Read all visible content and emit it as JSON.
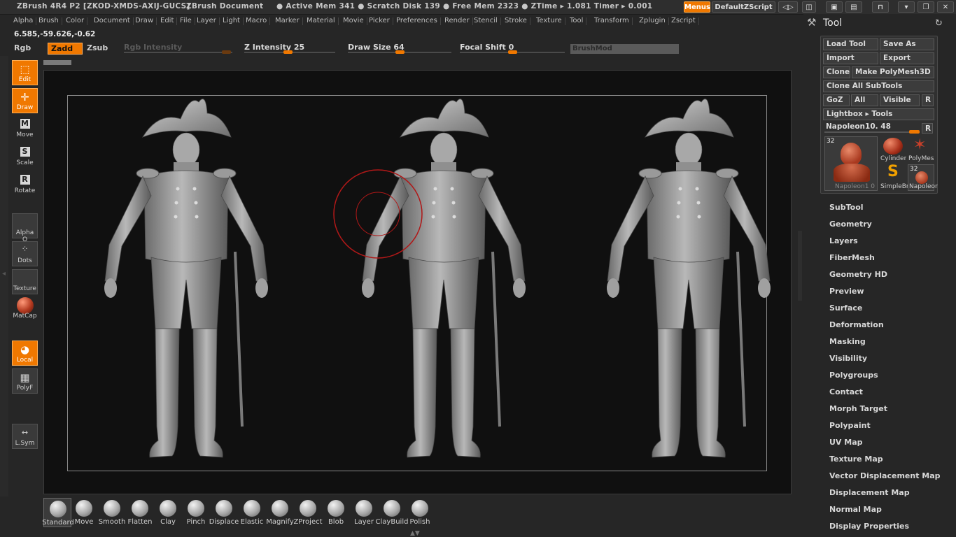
{
  "titlebar": {
    "app": "ZBrush 4R4 P2 [ZKOD-XMDS-AXIJ-GUCS]",
    "doc": "ZBrush Document",
    "stats": "● Active Mem 341  ● Scratch Disk 139  ● Free Mem 2323  ● ZTime ▸ 1.081  Timer ▸ 0.001",
    "menus_btn": "Menus",
    "script_btn": "DefaultZScript"
  },
  "menubar": {
    "items": [
      "Alpha",
      "Brush",
      "Color",
      "Document",
      "Draw",
      "Edit",
      "File",
      "Layer",
      "Light",
      "Macro",
      "Marker",
      "Material",
      "Movie",
      "Picker",
      "Preferences",
      "Render",
      "Stencil",
      "Stroke",
      "Texture",
      "Tool",
      "Transform",
      "Zplugin",
      "Zscript"
    ]
  },
  "coords": "6.585,-59.626,-0.62",
  "options": {
    "rgb": "Rgb",
    "zadd": "Zadd",
    "zsub": "Zsub",
    "rgb_intensity": "Rgb Intensity",
    "z_intensity": "Z Intensity 25",
    "draw_size": "Draw Size 64",
    "focal_shift": "Focal Shift 0",
    "brushmod": "BrushMod",
    "z_intensity_value": 25,
    "draw_size_value": 64,
    "focal_shift_value": 0
  },
  "left_shelf": {
    "edit": "Edit",
    "draw": "Draw",
    "move": "Move",
    "scale": "Scale",
    "rotate": "Rotate",
    "alpha": "Alpha O",
    "dots": "Dots",
    "texture": "Texture",
    "matcap": "MatCap",
    "local": "Local",
    "polyf": "PolyF",
    "lsym": "L.Sym"
  },
  "brushes": [
    "Standard",
    "Move",
    "Smooth",
    "Flatten",
    "Clay",
    "Pinch",
    "Displace",
    "Elastic",
    "Magnify",
    "ZProject",
    "Blob",
    "Layer",
    "ClayBuild",
    "Polish"
  ],
  "tool_palette": {
    "title": "Tool",
    "load_tool": "Load Tool",
    "save_as": "Save As",
    "import": "Import",
    "export": "Export",
    "clone": "Clone",
    "make_polymesh": "Make PolyMesh3D",
    "clone_all": "Clone All SubTools",
    "goz": "GoZ",
    "all": "All",
    "visible": "Visible",
    "r": "R",
    "lightbox": "Lightbox ▸ Tools",
    "current_tool": "Napoleon10. 48",
    "thumbs": {
      "main_count": "32",
      "main_label": "Napoleon1 0",
      "cylinder": "Cylinder",
      "polymesh": "PolyMes",
      "simplebrush": "SimpleBr",
      "napoleon_count": "32",
      "napoleon_small": "Napoleor"
    },
    "sections": [
      "SubTool",
      "Geometry",
      "Layers",
      "FiberMesh",
      "Geometry HD",
      "Preview",
      "Surface",
      "Deformation",
      "Masking",
      "Visibility",
      "Polygroups",
      "Contact",
      "Morph Target",
      "Polypaint",
      "UV Map",
      "Texture Map",
      "Vector Displacement Map",
      "Displacement Map",
      "Normal Map",
      "Display Properties"
    ]
  },
  "colors": {
    "accent": "#f07800",
    "canvas": "#101010",
    "panel": "#262626"
  }
}
